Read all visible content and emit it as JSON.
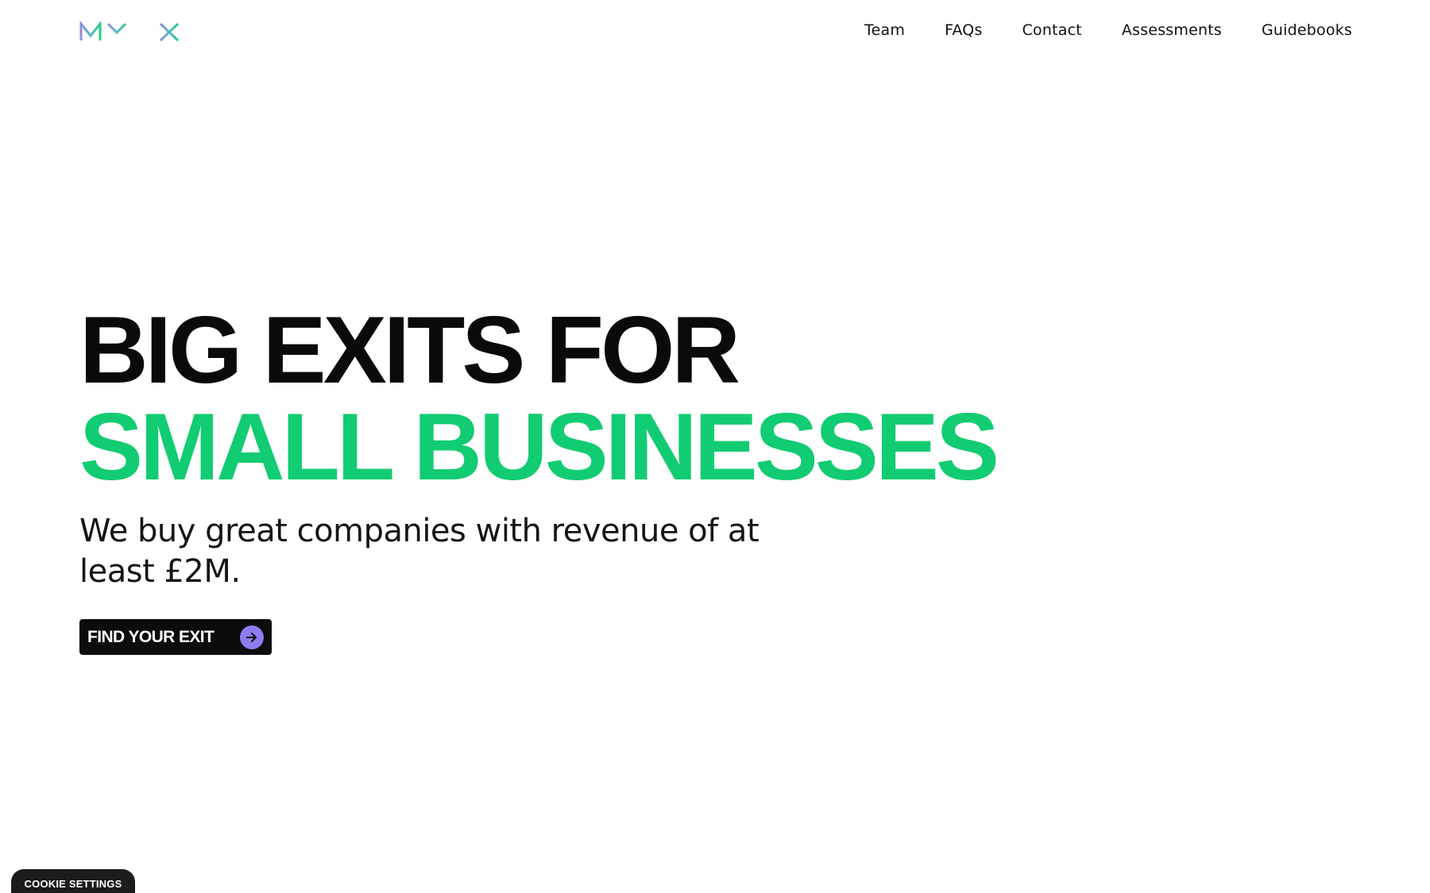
{
  "brand": {
    "logo_text": "MYEXIT",
    "logo_colors": {
      "start": "#7f92d6",
      "end": "#2fcf8a"
    }
  },
  "nav": {
    "items": [
      {
        "label": "Team"
      },
      {
        "label": "FAQs"
      },
      {
        "label": "Contact"
      },
      {
        "label": "Assessments"
      },
      {
        "label": "Guidebooks"
      }
    ]
  },
  "hero": {
    "headline_line1": "BIG EXITS FOR",
    "headline_line2": "SMALL BUSINESSES",
    "subtitle": "We buy great companies with revenue of at least £2M.",
    "cta_label": "FIND YOUR EXIT",
    "cta_icon": "arrow-right-icon"
  },
  "cookie": {
    "label": "COOKIE SETTINGS"
  },
  "colors": {
    "accent_green": "#11cc72",
    "cta_background": "#0c0c0c",
    "cta_icon_background": "#8c7cf2",
    "text_dark": "#0a0a0a"
  }
}
